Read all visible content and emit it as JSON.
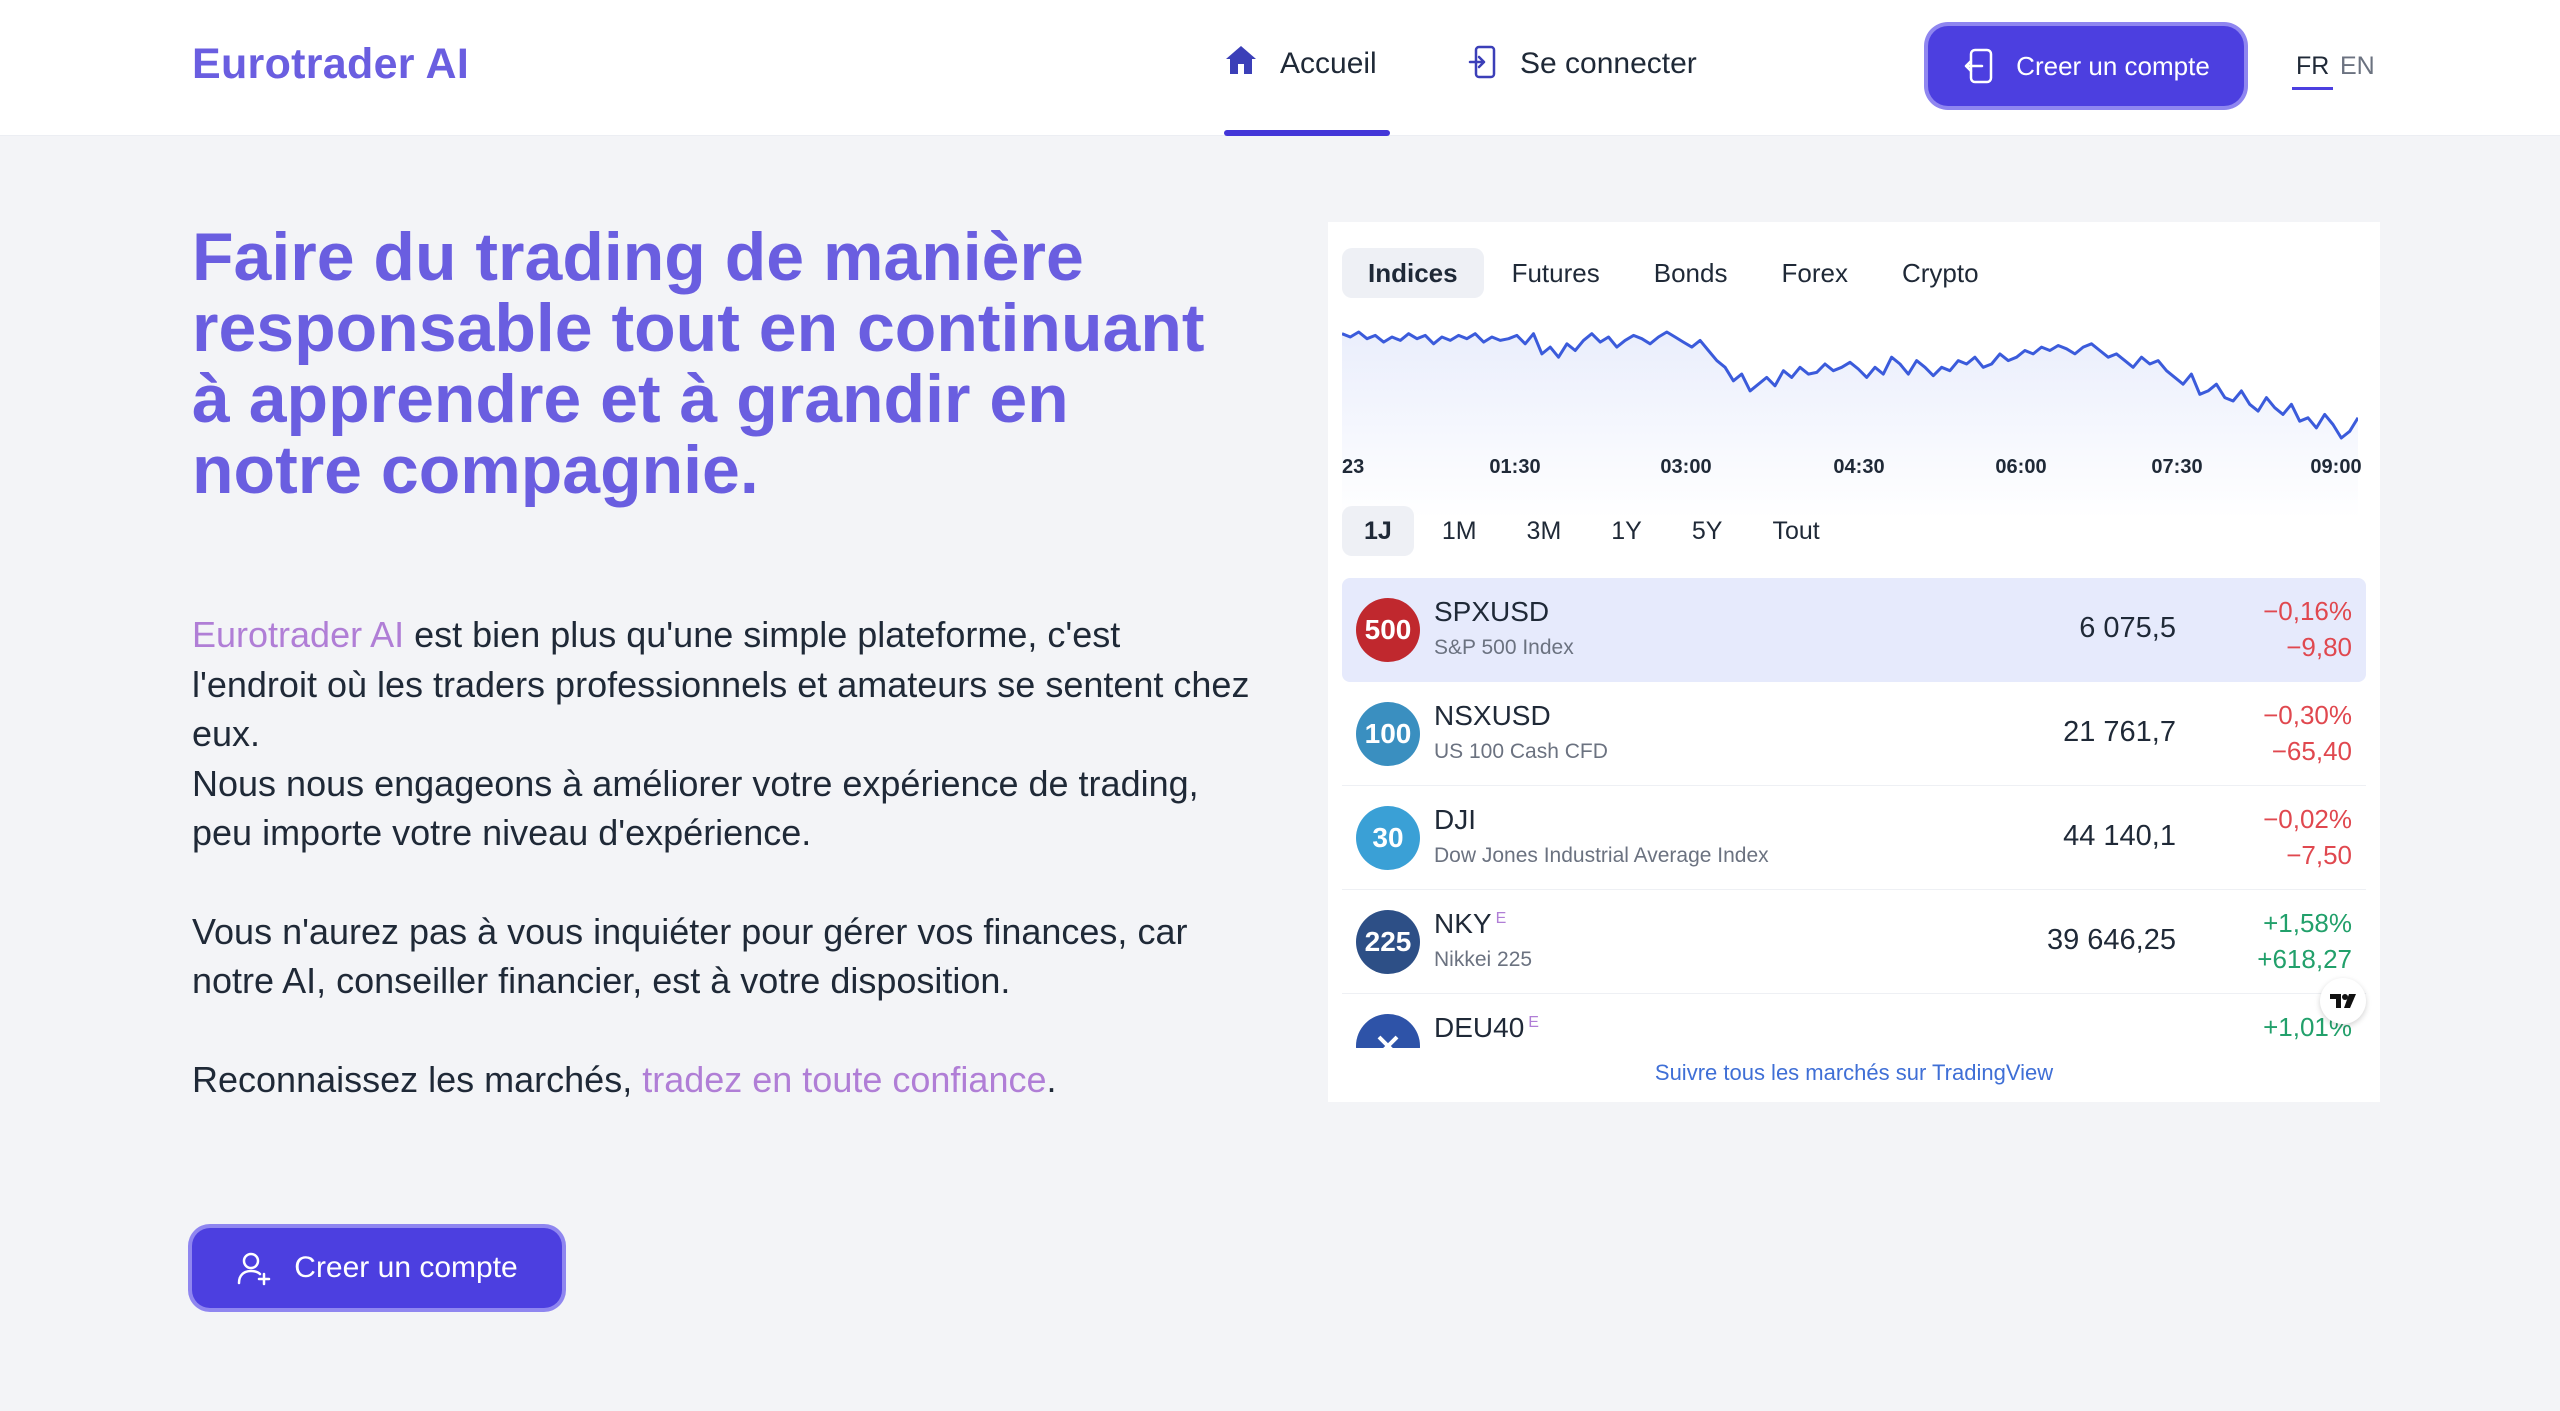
{
  "header": {
    "logo": "Eurotrader AI",
    "nav": [
      {
        "label": "Accueil",
        "icon": "home-icon"
      },
      {
        "label": "Se connecter",
        "icon": "login-icon"
      }
    ],
    "cta_label": "Creer un compte",
    "languages": [
      "FR",
      "EN"
    ],
    "active_language": "FR"
  },
  "hero": {
    "title": "Faire du trading de manière responsable tout en continuant à apprendre et à grandir en notre compagnie.",
    "p1_brand": "Eurotrader AI",
    "p1_rest": " est bien plus qu'une simple plateforme, c'est l'endroit où les traders professionnels et amateurs se sentent chez eux.",
    "p1_line2": "Nous nous engageons à améliorer votre expérience de trading, peu importe votre niveau d'expérience.",
    "p2": "Vous n'aurez pas à vous inquiéter pour gérer vos finances, car notre AI, conseiller financier, est à votre disposition.",
    "p3_start": "Reconnaissez les marchés, ",
    "p3_accent": "tradez en toute confiance",
    "p3_end": ".",
    "cta_label": "Creer un compte"
  },
  "widget": {
    "tabs": [
      "Indices",
      "Futures",
      "Bonds",
      "Forex",
      "Crypto"
    ],
    "active_tab": "Indices",
    "ranges": [
      "1J",
      "1M",
      "3M",
      "1Y",
      "5Y",
      "Tout"
    ],
    "active_range": "1J",
    "symbols": [
      {
        "badge": "500",
        "badge_color": "#c0282e",
        "symbol": "SPXUSD",
        "sup": "",
        "description": "S&P 500 Index",
        "price": "6 075,5",
        "change_pct": "−0,16%",
        "change": "−9,80",
        "direction": "down",
        "selected": true
      },
      {
        "badge": "100",
        "badge_color": "#3a8fc0",
        "symbol": "NSXUSD",
        "sup": "",
        "description": "US 100 Cash CFD",
        "price": "21 761,7",
        "change_pct": "−0,30%",
        "change": "−65,40",
        "direction": "down",
        "selected": false
      },
      {
        "badge": "30",
        "badge_color": "#3aa0d6",
        "symbol": "DJI",
        "sup": "",
        "description": "Dow Jones Industrial Average Index",
        "price": "44 140,1",
        "change_pct": "−0,02%",
        "change": "−7,50",
        "direction": "down",
        "selected": false
      },
      {
        "badge": "225",
        "badge_color": "#2d4f86",
        "symbol": "NKY",
        "sup": "E",
        "description": "Nikkei 225",
        "price": "39 646,25",
        "change_pct": "+1,58%",
        "change": "+618,27",
        "direction": "up",
        "selected": false
      },
      {
        "badge": "",
        "badge_color": "#2e53a8",
        "symbol": "DEU40",
        "sup": "E",
        "description": "",
        "price": "",
        "change_pct": "+1,01%",
        "change": "",
        "direction": "up",
        "selected": false
      }
    ],
    "follow_link": "Suivre tous les marchés sur TradingView",
    "tv_logo": "TV"
  },
  "chart_data": {
    "type": "line",
    "x_ticks": [
      "23",
      "01:30",
      "03:00",
      "04:30",
      "06:00",
      "07:30",
      "09:00"
    ],
    "values": [
      10,
      12,
      9,
      13,
      11,
      15,
      12,
      14,
      10,
      13,
      11,
      16,
      12,
      14,
      11,
      13,
      10,
      15,
      12,
      14,
      13,
      11,
      16,
      10,
      22,
      18,
      24,
      16,
      20,
      14,
      10,
      15,
      12,
      18,
      14,
      11,
      13,
      16,
      12,
      9,
      12,
      15,
      18,
      14,
      20,
      26,
      30,
      38,
      34,
      44,
      40,
      36,
      41,
      32,
      36,
      30,
      34,
      33,
      28,
      32,
      30,
      27,
      31,
      36,
      30,
      34,
      24,
      28,
      34,
      26,
      30,
      35,
      30,
      32,
      26,
      28,
      24,
      30,
      28,
      22,
      26,
      24,
      20,
      22,
      18,
      20,
      17,
      19,
      22,
      18,
      16,
      20,
      24,
      22,
      26,
      30,
      24,
      28,
      26,
      32,
      36,
      40,
      34,
      46,
      44,
      40,
      48,
      50,
      44,
      52,
      56,
      48,
      54,
      58,
      52,
      62,
      60,
      66,
      58,
      64,
      72,
      68,
      60
    ],
    "color": "#3b5bdb",
    "fill": "#eaeefc",
    "grid": false
  }
}
